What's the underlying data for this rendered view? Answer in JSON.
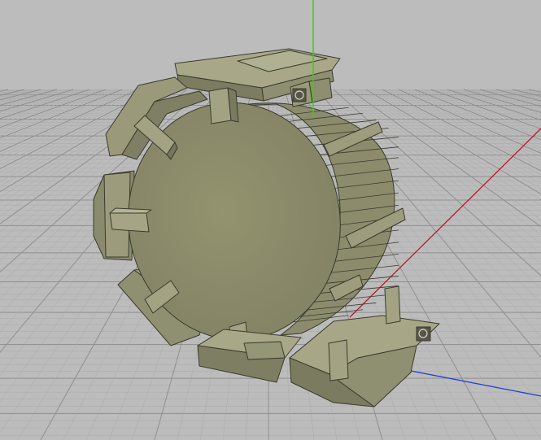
{
  "viewport": {
    "background": "#bcbcbc",
    "grid_minor_color": "#aaaaaa",
    "grid_major_color": "#8f8f8f"
  },
  "axes": {
    "x_color": "#c1121f",
    "y_color": "#39d400",
    "z_color": "#1f3fd1"
  },
  "model": {
    "face_color": "#8b8b6c",
    "face_light": "#a6a687",
    "face_dark": "#6f6f54",
    "edge_color": "#3a3a2e"
  }
}
